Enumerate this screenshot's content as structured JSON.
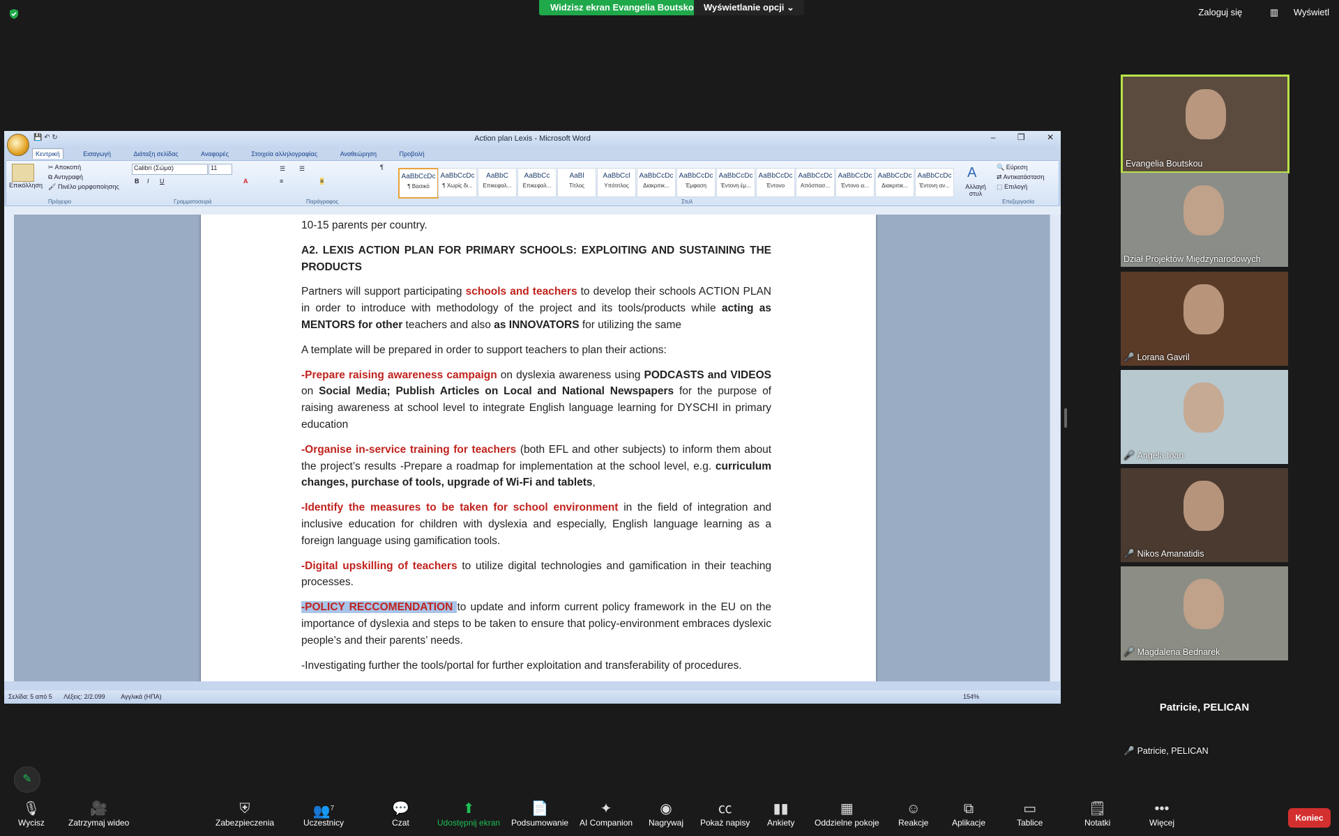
{
  "zoom_top": {
    "share_banner": "Widzisz ekran Evangelia Boutskou",
    "view_options": "Wyświetlanie opcji",
    "sign_in": "Zaloguj się",
    "view": "Wyświetl"
  },
  "word": {
    "title": "Action plan Lexis - Microsoft Word",
    "tabs": [
      "Κεντρική",
      "Εισαγωγή",
      "Διάταξη σελίδας",
      "Αναφορές",
      "Στοιχεία αλληλογραφίας",
      "Αναθεώρηση",
      "Προβολή"
    ],
    "clipboard": {
      "paste": "Επικόλληση",
      "cut": "Αποκοπή",
      "copy": "Αντιγραφή",
      "format_painter": "Πινέλο μορφοποίησης",
      "label": "Πρόχειρο"
    },
    "font": {
      "name": "Calibri (Σώμα)",
      "size": "11",
      "label": "Γραμματοσειρά"
    },
    "paragraph_label": "Παράγραφος",
    "styles_label": "Στυλ",
    "styles": [
      {
        "sample": "AaBbCcDc",
        "name": "¶ Βασικό"
      },
      {
        "sample": "AaBbCcDc",
        "name": "¶ Χωρίς δι..."
      },
      {
        "sample": "AaBbC",
        "name": "Επικεφαλ..."
      },
      {
        "sample": "AaBbCc",
        "name": "Επικεφαλ..."
      },
      {
        "sample": "AaBl",
        "name": "Τίτλος"
      },
      {
        "sample": "AaBbCcl",
        "name": "Υπότιτλος"
      },
      {
        "sample": "AaBbCcDc",
        "name": "Διακριτικ..."
      },
      {
        "sample": "AaBbCcDc",
        "name": "Έμφαση"
      },
      {
        "sample": "AaBbCcDc",
        "name": "Έντονη έμ..."
      },
      {
        "sample": "AaBbCcDc",
        "name": "Έντονο"
      },
      {
        "sample": "AaBbCcDc",
        "name": "Απόσπασ..."
      },
      {
        "sample": "AaBbCcDc",
        "name": "Έντονο ει..."
      },
      {
        "sample": "AaBbCcDc",
        "name": "Διακριτικ..."
      },
      {
        "sample": "AaBbCcDc",
        "name": "Έντονη αν..."
      }
    ],
    "change_styles": "Αλλαγή στυλ",
    "editing": {
      "find": "Εύρεση",
      "replace": "Αντικατάσταση",
      "select": "Επιλογή",
      "label": "Επεξεργασία"
    },
    "document": {
      "p0": "10-15 parents per country.",
      "p1": "A2. LEXIS ACTION PLAN FOR PRIMARY SCHOOLS: EXPLOITING AND SUSTAINING THE PRODUCTS",
      "p2a": "Partners will support participating ",
      "p2b": "schools and teachers",
      "p2c": " to develop their schools ACTION PLAN in order to introduce with methodology of the project and its tools/products while ",
      "p2d": "acting as MENTORS for other",
      "p2e": " teachers and also ",
      "p2f": "as INNOVATORS",
      "p2g": " for utilizing the same",
      "p3": "A template will be prepared in order to support teachers to plan their actions:",
      "p4a": "-Prepare raising awareness campaign",
      "p4b": " on dyslexia awareness using ",
      "p4c": "PODCASTS and VIDEOS",
      "p4d": " on ",
      "p4e": "Social Media; Publish Articles on Local and National Newspapers",
      "p4f": " for the purpose of raising awareness at school level to integrate English language learning for DYSCHI in primary education",
      "p5a": "-Organise in-service training for teachers",
      "p5b": " (both EFL and other subjects) to inform them about the project’s results -Prepare a roadmap for implementation at the school level, e.g. ",
      "p5c": "curriculum changes, purchase of tools, upgrade of Wi-Fi and tablets",
      "p5d": ",",
      "p6a": "-Identify the measures to be taken for school environment",
      "p6b": " in the field of integration and inclusive education for children with dyslexia and especially, English language learning as a foreign language using gamification tools.",
      "p7a": "-Digital upskilling of teachers",
      "p7b": " to utilize digital technologies and gamification in their teaching processes.",
      "p8a": "-POLICY RECCOMENDATION ",
      "p8b": "to update and inform current policy framework in the EU on the importance of dyslexia and steps to be taken to ensure that policy-environment embraces dyslexic people’s and their parents’ needs.",
      "p9": "-Investigating further the tools/portal for further exploitation and transferability of procedures."
    },
    "status": {
      "page": "Σελίδα: 5 από 5",
      "words": "Λέξεις: 2/2.099",
      "language": "Αγγλικά (ΗΠΑ)",
      "zoom": "154%"
    }
  },
  "participants": [
    {
      "name": "Evangelia Boutskou",
      "muted": false,
      "bg": "#5b4b3f"
    },
    {
      "name": "Dział Projektów Międzynarodowych",
      "muted": false,
      "bg": "#8a8d88"
    },
    {
      "name": "Lorana Gavril",
      "muted": true,
      "bg": "#5a3b28"
    },
    {
      "name": "Angela Ioan",
      "muted": true,
      "bg": "#b7c8cf"
    },
    {
      "name": "Nikos Amanatidis",
      "muted": true,
      "bg": "#4a3a30"
    },
    {
      "name": "Magdalena Bednarek",
      "muted": true,
      "bg": "#8c8e86"
    },
    {
      "name": "Patricie, PELICAN",
      "muted": true,
      "bg": "#1a1a1a",
      "center_text": "Patricie, PELICAN"
    }
  ],
  "toolbar": {
    "mute": "Wycisz",
    "stop_video": "Zatrzymaj wideo",
    "security": "Zabezpieczenia",
    "participants": "Uczestnicy",
    "participants_count": "7",
    "chat": "Czat",
    "share": "Udostępnij ekran",
    "summary": "Podsumowanie",
    "ai": "AI Companion",
    "record": "Nagrywaj",
    "captions": "Pokaż napisy",
    "polls": "Ankiety",
    "breakout": "Oddzielne pokoje",
    "reactions": "Reakcje",
    "apps": "Aplikacje",
    "whiteboards": "Tablice",
    "notes": "Notatki",
    "more": "Więcej",
    "end": "Koniec"
  },
  "colors": {
    "share_green": "#1fa94b",
    "end_red": "#d32f2f",
    "active_speaker": "#b9e34a"
  }
}
